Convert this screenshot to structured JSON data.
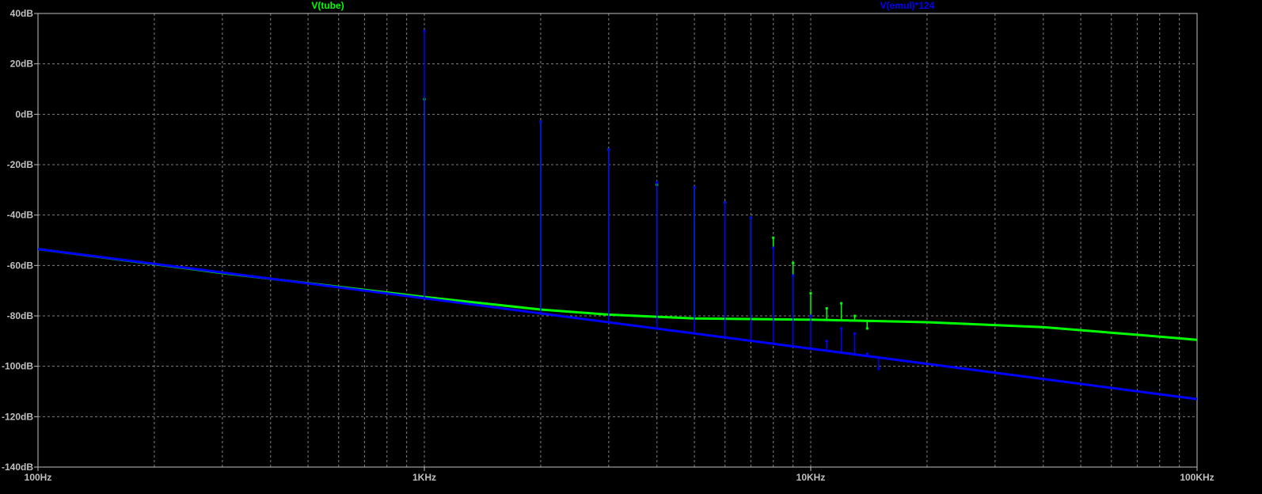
{
  "chart_data": {
    "type": "line",
    "x_scale": "log",
    "xlim": [
      100,
      100000
    ],
    "ylim": [
      -140,
      40
    ],
    "x_ticks": [
      {
        "value": 100,
        "label": "100Hz"
      },
      {
        "value": 1000,
        "label": "1KHz"
      },
      {
        "value": 10000,
        "label": "10KHz"
      },
      {
        "value": 100000,
        "label": "100KHz"
      }
    ],
    "y_ticks": [
      {
        "value": 40,
        "label": "40dB"
      },
      {
        "value": 20,
        "label": "20dB"
      },
      {
        "value": 0,
        "label": "0dB"
      },
      {
        "value": -20,
        "label": "-20dB"
      },
      {
        "value": -40,
        "label": "-40dB"
      },
      {
        "value": -60,
        "label": "-60dB"
      },
      {
        "value": -80,
        "label": "-80dB"
      },
      {
        "value": -100,
        "label": "-100dB"
      },
      {
        "value": -120,
        "label": "-120dB"
      },
      {
        "value": -140,
        "label": "-140dB"
      }
    ],
    "grid": true,
    "background": "#000000",
    "series": [
      {
        "name": "V(tube)",
        "color": "#00ff00",
        "floor": [
          [
            100,
            -53.5
          ],
          [
            300,
            -63
          ],
          [
            1000,
            -72.5
          ],
          [
            2000,
            -77.5
          ],
          [
            3000,
            -79.5
          ],
          [
            5000,
            -81
          ],
          [
            10000,
            -81.5
          ],
          [
            20000,
            -82.5
          ],
          [
            40000,
            -84.5
          ],
          [
            70000,
            -87.5
          ],
          [
            100000,
            -89.5
          ]
        ],
        "peaks": [
          [
            1000,
            6
          ],
          [
            2000,
            -3
          ],
          [
            3000,
            -14
          ],
          [
            4000,
            -28
          ],
          [
            5000,
            -29
          ],
          [
            6000,
            -35
          ],
          [
            7000,
            -41
          ],
          [
            8000,
            -49
          ],
          [
            9000,
            -59
          ],
          [
            10000,
            -71
          ],
          [
            11000,
            -77
          ],
          [
            12000,
            -75
          ],
          [
            13000,
            -80
          ],
          [
            14000,
            -85
          ]
        ]
      },
      {
        "name": "V(emul)*124",
        "color": "#0000ff",
        "floor": [
          [
            100,
            -53.5
          ],
          [
            1000,
            -73
          ],
          [
            10000,
            -93
          ],
          [
            100000,
            -113
          ]
        ],
        "peaks": [
          [
            1000,
            33
          ],
          [
            2000,
            -3
          ],
          [
            3000,
            -14
          ],
          [
            4000,
            -27
          ],
          [
            5000,
            -29
          ],
          [
            6000,
            -35
          ],
          [
            7000,
            -41
          ],
          [
            8000,
            -53
          ],
          [
            9000,
            -64
          ],
          [
            10000,
            -80
          ],
          [
            11000,
            -90
          ],
          [
            12000,
            -85
          ],
          [
            13000,
            -87
          ],
          [
            14000,
            -95
          ],
          [
            15000,
            -101
          ]
        ]
      }
    ]
  }
}
